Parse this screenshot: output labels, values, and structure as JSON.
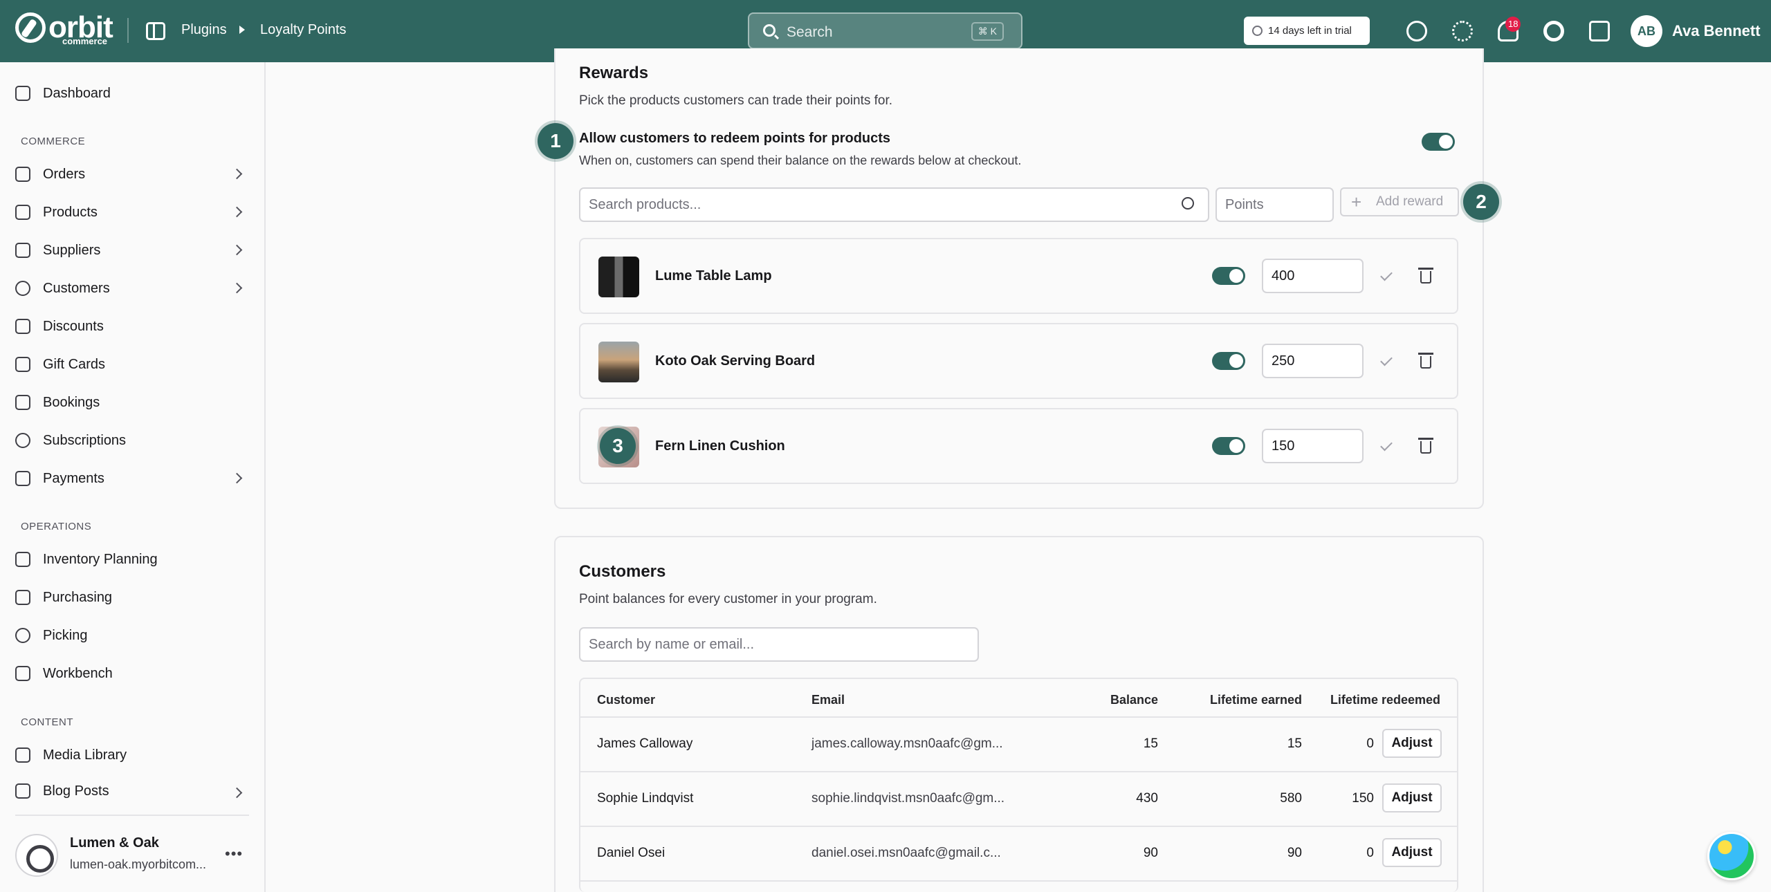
{
  "brand": {
    "name": "orbit",
    "sub": "commerce"
  },
  "breadcrumb": {
    "parent": "Plugins",
    "current": "Loyalty Points"
  },
  "search": {
    "placeholder": "Search",
    "shortcut": "⌘ K"
  },
  "trial": {
    "label": "14 days left in trial"
  },
  "notifications": {
    "count": "18"
  },
  "user": {
    "initials": "AB",
    "name": "Ava Bennett"
  },
  "sidebar": {
    "dashboard": "Dashboard",
    "section_commerce": "COMMERCE",
    "commerce": [
      "Orders",
      "Products",
      "Suppliers",
      "Customers",
      "Discounts",
      "Gift Cards",
      "Bookings",
      "Subscriptions",
      "Payments"
    ],
    "section_operations": "OPERATIONS",
    "operations": [
      "Inventory Planning",
      "Purchasing",
      "Picking",
      "Workbench"
    ],
    "section_content": "CONTENT",
    "content": [
      "Media Library",
      "Blog Posts"
    ],
    "store": {
      "name": "Lumen & Oak",
      "url": "lumen-oak.myorbitcom..."
    }
  },
  "rewards": {
    "title": "Rewards",
    "description": "Pick the products customers can trade their points for.",
    "redeem_title": "Allow customers to redeem points for products",
    "redeem_desc": "When on, customers can spend their balance on the rewards below at checkout.",
    "redeem_enabled": true,
    "search_placeholder": "Search products...",
    "points_placeholder": "Points",
    "add_label": "Add reward",
    "items": [
      {
        "name": "Lume Table Lamp",
        "enabled": true,
        "points": "400"
      },
      {
        "name": "Koto Oak Serving Board",
        "enabled": true,
        "points": "250"
      },
      {
        "name": "Fern Linen Cushion",
        "enabled": true,
        "points": "150"
      }
    ]
  },
  "steps": [
    "1",
    "2",
    "3"
  ],
  "customers": {
    "title": "Customers",
    "description": "Point balances for every customer in your program.",
    "search_placeholder": "Search by name or email...",
    "columns": [
      "Customer",
      "Email",
      "Balance",
      "Lifetime earned",
      "Lifetime redeemed"
    ],
    "adjust_label": "Adjust",
    "rows": [
      {
        "name": "James Calloway",
        "email": "james.calloway.msn0aafc@gm...",
        "balance": "15",
        "earned": "15",
        "redeemed": "0"
      },
      {
        "name": "Sophie Lindqvist",
        "email": "sophie.lindqvist.msn0aafc@gm...",
        "balance": "430",
        "earned": "580",
        "redeemed": "150"
      },
      {
        "name": "Daniel Osei",
        "email": "daniel.osei.msn0aafc@gmail.c...",
        "balance": "90",
        "earned": "90",
        "redeemed": "0"
      }
    ]
  },
  "colors": {
    "brand": "#2f6660",
    "badge": "#e11d48"
  }
}
